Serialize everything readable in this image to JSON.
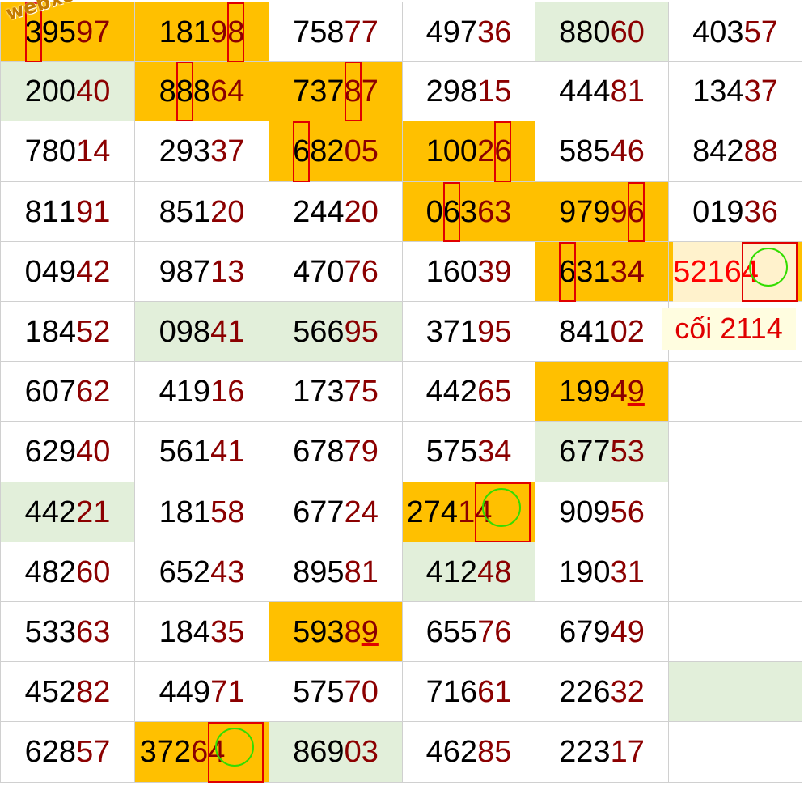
{
  "watermark": "webxoso.net",
  "note": "cối 2114",
  "colors": {
    "orange_highlight": "#ffc000",
    "green_highlight": "#e2efda",
    "tail_red": "#8b0000",
    "marker_red": "#e00000",
    "circle_green": "#33dd00"
  },
  "columns": [
    [
      {
        "v": "39597",
        "bg": "orange",
        "box": [
          0
        ],
        "circle": null
      },
      {
        "v": "20040",
        "bg": "green"
      },
      {
        "v": "78014"
      },
      {
        "v": "81191"
      },
      {
        "v": "04942"
      },
      {
        "v": "18452"
      },
      {
        "v": "60762"
      },
      {
        "v": "62940"
      },
      {
        "v": "44221",
        "bg": "green"
      },
      {
        "v": "48260"
      },
      {
        "v": "53363"
      },
      {
        "v": "45282"
      },
      {
        "v": "62857"
      }
    ],
    [
      {
        "v": "18198",
        "bg": "orange",
        "box": [
          4
        ]
      },
      {
        "v": "88864",
        "bg": "orange",
        "box": [
          1
        ]
      },
      {
        "v": "29337"
      },
      {
        "v": "85120"
      },
      {
        "v": "98713"
      },
      {
        "v": "09841",
        "bg": "green"
      },
      {
        "v": "41916"
      },
      {
        "v": "56141"
      },
      {
        "v": "18158"
      },
      {
        "v": "65243"
      },
      {
        "v": "18435"
      },
      {
        "v": "44971"
      },
      {
        "v": "37264",
        "bg": "orange",
        "box": [
          4
        ],
        "circle": 4
      }
    ],
    [
      {
        "v": "75877"
      },
      {
        "v": "73787",
        "bg": "orange",
        "box": [
          3
        ]
      },
      {
        "v": "68205",
        "bg": "orange",
        "box": [
          0
        ]
      },
      {
        "v": "24420"
      },
      {
        "v": "47076"
      },
      {
        "v": "56695",
        "bg": "green"
      },
      {
        "v": "17375"
      },
      {
        "v": "67879"
      },
      {
        "v": "67724"
      },
      {
        "v": "89581"
      },
      {
        "v": "59389",
        "bg": "orange",
        "ul": [
          4
        ]
      },
      {
        "v": "57570"
      },
      {
        "v": "86903",
        "bg": "green"
      }
    ],
    [
      {
        "v": "49736"
      },
      {
        "v": "29815"
      },
      {
        "v": "10026",
        "bg": "orange",
        "box": [
          4
        ]
      },
      {
        "v": "06363",
        "bg": "orange",
        "box": [
          1
        ]
      },
      {
        "v": "16039"
      },
      {
        "v": "37195"
      },
      {
        "v": "44265"
      },
      {
        "v": "57534"
      },
      {
        "v": "27414",
        "bg": "orange",
        "box": [
          4
        ],
        "circle": 4
      },
      {
        "v": "41248",
        "bg": "green"
      },
      {
        "v": "65576"
      },
      {
        "v": "71661"
      },
      {
        "v": "46285"
      }
    ],
    [
      {
        "v": "88060",
        "bg": "green"
      },
      {
        "v": "44481"
      },
      {
        "v": "58546"
      },
      {
        "v": "97996",
        "bg": "orange",
        "box": [
          4
        ]
      },
      {
        "v": "63134",
        "bg": "orange",
        "box": [
          0
        ]
      },
      {
        "v": "84102"
      },
      {
        "v": "19949",
        "bg": "orange",
        "ul": [
          4
        ]
      },
      {
        "v": "67753",
        "bg": "green"
      },
      {
        "v": "90956"
      },
      {
        "v": "19031"
      },
      {
        "v": "67949"
      },
      {
        "v": "22632"
      },
      {
        "v": "22317"
      }
    ],
    [
      {
        "v": "40357"
      },
      {
        "v": "13437"
      },
      {
        "v": "84288"
      },
      {
        "v": "01936"
      },
      {
        "v": "52164",
        "bg": "orange",
        "box": [
          4
        ],
        "circle": 4,
        "special": true
      },
      {
        "v": ""
      },
      {
        "v": ""
      },
      {
        "v": ""
      },
      {
        "v": ""
      },
      {
        "v": ""
      },
      {
        "v": ""
      },
      {
        "v": "",
        "bg": "green"
      },
      {
        "v": ""
      }
    ]
  ]
}
